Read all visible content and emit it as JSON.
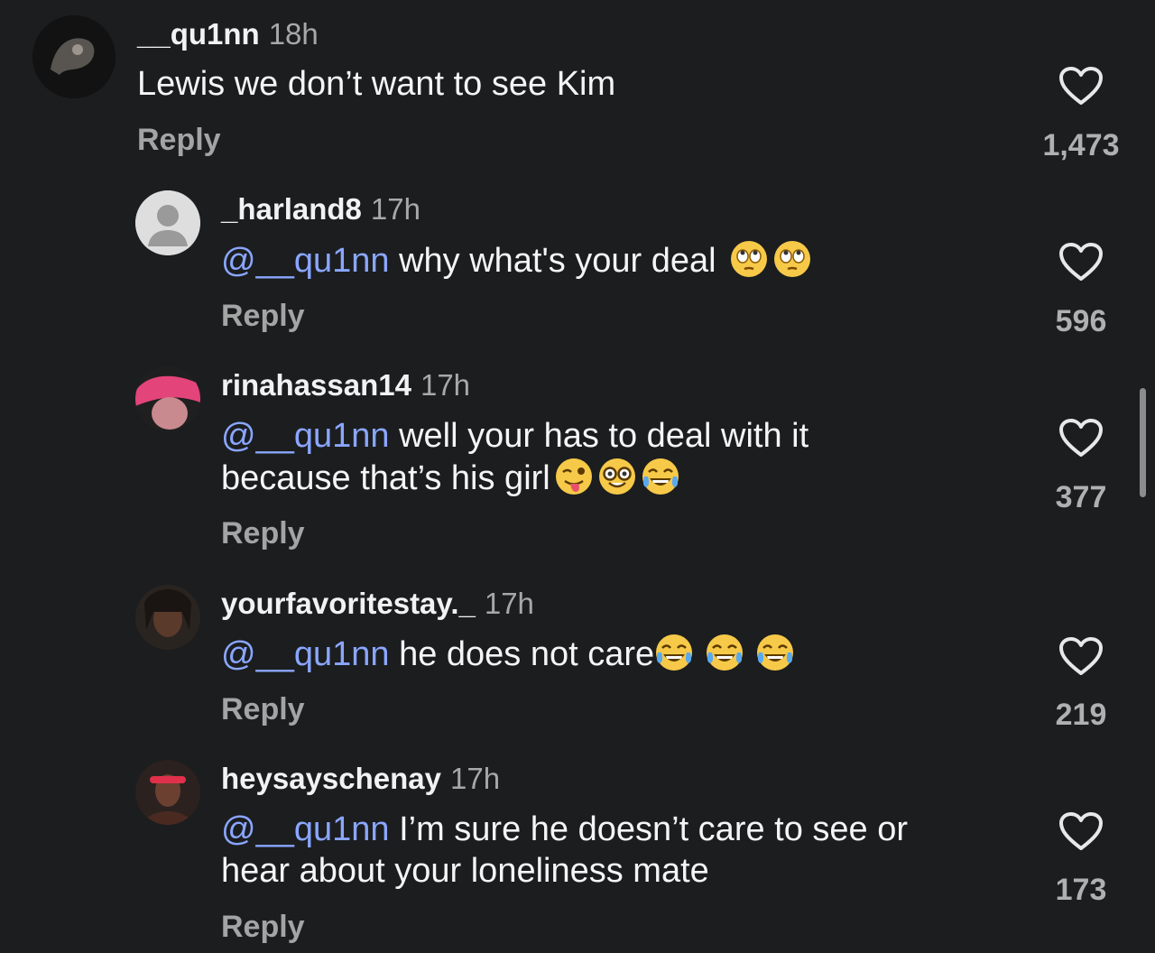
{
  "comments": [
    {
      "username": "__qu1nn",
      "time": "18h",
      "mention": "",
      "lines": [
        "Lewis we don’t want to see Kim"
      ],
      "emojis": [],
      "reply_label": "Reply",
      "likes": "1,473",
      "avatar": "avatar-image"
    },
    {
      "username": "_harland8",
      "time": "17h",
      "mention": "@__qu1nn",
      "lines": [
        " why what's your deal "
      ],
      "emojis": [
        "eye-roll-emoji",
        "eye-roll-emoji"
      ],
      "reply_label": "Reply",
      "likes": "596",
      "avatar": "default-person-avatar"
    },
    {
      "username": "rinahassan14",
      "time": "17h",
      "mention": "@__qu1nn",
      "lines": [
        " well your has to deal with it",
        "because that’s his girl"
      ],
      "emojis": [
        "winking-tongue-emoji",
        "nerd-face-emoji",
        "tears-of-joy-emoji"
      ],
      "reply_label": "Reply",
      "likes": "377",
      "avatar": "avatar-image"
    },
    {
      "username": "yourfavoritestay._",
      "time": "17h",
      "mention": "@__qu1nn",
      "lines": [
        " he does not care"
      ],
      "emojis": [
        "tears-of-joy-emoji",
        "tears-of-joy-emoji",
        "tears-of-joy-emoji"
      ],
      "reply_label": "Reply",
      "likes": "219",
      "avatar": "avatar-image"
    },
    {
      "username": "heysayschenay",
      "time": "17h",
      "mention": "@__qu1nn",
      "lines": [
        " I’m sure he doesn’t care to see or",
        "hear about your loneliness mate"
      ],
      "emojis": [],
      "reply_label": "Reply",
      "likes": "173",
      "avatar": "avatar-image"
    }
  ],
  "colors": {
    "background": "#1b1d1f",
    "mention": "#8aa6ff",
    "secondary_text": "#a8a8a8"
  }
}
